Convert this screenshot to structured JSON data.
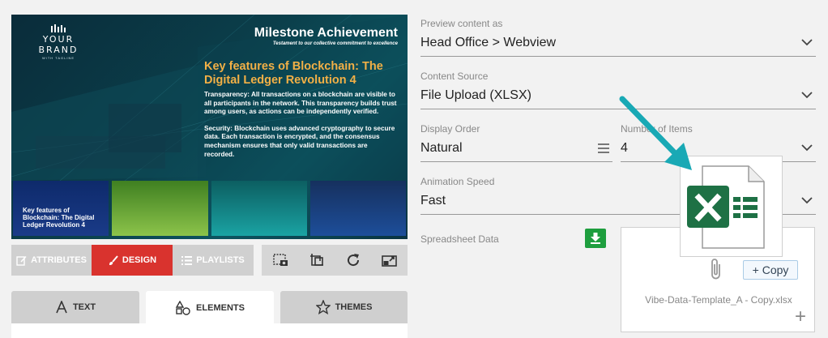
{
  "preview": {
    "brand_name": "YOUR BRAND",
    "brand_tagline": "WITH TAGLINE",
    "title": "Milestone Achievement",
    "subtitle": "Testament to our collective commitment to excellence",
    "heading": "Key features of Blockchain: The Digital Ledger Revolution 4",
    "paragraphs": [
      "Transparency: All transactions on a blockchain are visible to all participants in the network. This transparency builds trust among users, as actions can be independently verified.",
      "Security: Blockchain uses advanced cryptography to secure data. Each transaction is encrypted, and the consensus mechanism ensures that only valid transactions are recorded."
    ],
    "thumbnails": [
      {
        "caption": "Key features of Blockchain: The Digital Ledger Revolution 4",
        "color": "#1a3b88"
      },
      {
        "caption": "",
        "color": "#8cc34a"
      },
      {
        "caption": "",
        "color": "#1aa3a3"
      },
      {
        "caption": "",
        "color": "#1d4e9a"
      }
    ]
  },
  "toolbar": {
    "attributes_label": "ATTRIBUTES",
    "design_label": "DESIGN",
    "playlists_label": "PLAYLISTS",
    "icons": [
      "screenshot-icon",
      "crop-icon",
      "refresh-icon",
      "resize-icon"
    ],
    "active_color": "#d9332e"
  },
  "tabs": {
    "text_label": "TEXT",
    "elements_label": "ELEMENTS",
    "themes_label": "THEMES",
    "active": "ELEMENTS"
  },
  "form": {
    "preview_as": {
      "label": "Preview content as",
      "value": "Head Office > Webview"
    },
    "content_source": {
      "label": "Content Source",
      "value": "File Upload (XLSX)"
    },
    "display_order": {
      "label": "Display Order",
      "value": "Natural"
    },
    "number_of_items": {
      "label": "Number of Items",
      "value": "4"
    },
    "animation_speed": {
      "label": "Animation Speed",
      "value": "Fast"
    },
    "spreadsheet_label": "Spreadsheet Data",
    "download_color": "#1e9e3e"
  },
  "upload": {
    "copy_label": "Copy",
    "file_name": "Vibe-Data-Template_A - Copy.xlsx",
    "excel_color": "#1e7145",
    "arrow_color": "#19a9b5"
  }
}
